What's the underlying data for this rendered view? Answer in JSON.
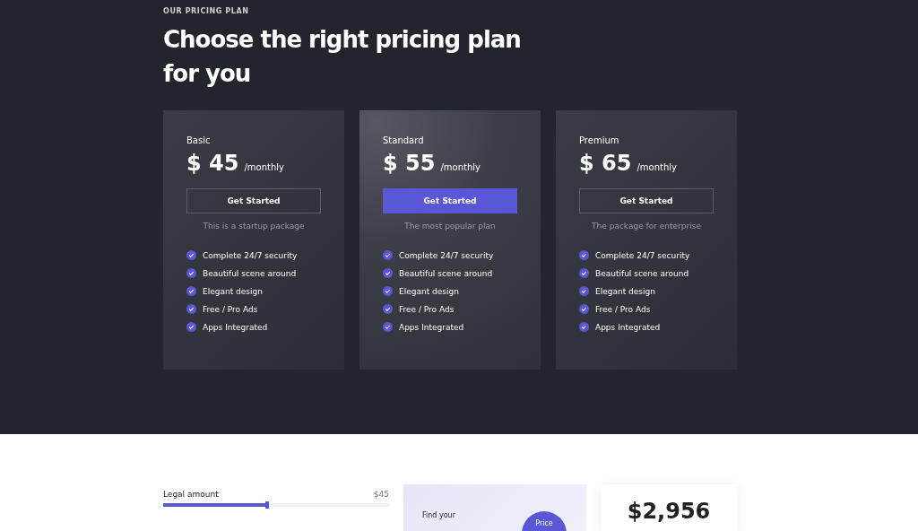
{
  "hero": {
    "eyebrow": "OUR PRICING PLAN",
    "title": "Choose the right pricing plan for you"
  },
  "plans": [
    {
      "name": "Basic",
      "price": "$ 45",
      "period": "/monthly",
      "button": "Get Started",
      "selected": false,
      "note": "This is a startup package",
      "features": [
        "Complete 24/7 security",
        "Beautiful scene around",
        "Elegant design",
        "Free / Pro Ads",
        "Apps Integrated"
      ]
    },
    {
      "name": "Standard",
      "price": "$ 55",
      "period": "/monthly",
      "button": "Get Started",
      "selected": true,
      "note": "The most popular plan",
      "features": [
        "Complete 24/7 security",
        "Beautiful scene around",
        "Elegant design",
        "Free / Pro Ads",
        "Apps Integrated"
      ]
    },
    {
      "name": "Premium",
      "price": "$ 65",
      "period": "/monthly",
      "button": "Get Started",
      "selected": false,
      "note": "The package for enterprise",
      "features": [
        "Complete 24/7 security",
        "Beautiful scene around",
        "Elegant design",
        "Free / Pro Ads",
        "Apps Integrated"
      ]
    }
  ],
  "calculator": {
    "slider": {
      "label": "Legal amount",
      "reading": "$45",
      "level": 0.46
    },
    "promo": {
      "text": "Find your",
      "badge": "Price"
    },
    "total": {
      "value": "$2,956"
    }
  }
}
